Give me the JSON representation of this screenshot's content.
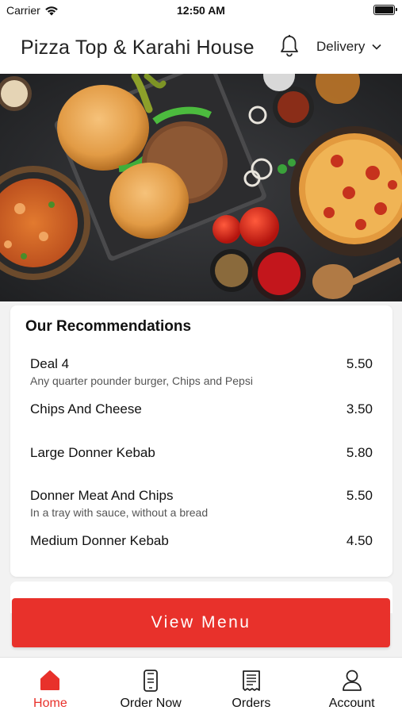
{
  "status_bar": {
    "carrier": "Carrier",
    "time": "12:50 AM"
  },
  "header": {
    "title": "Pizza Top & Karahi House",
    "order_type": "Delivery"
  },
  "recommendations": {
    "title": "Our Recommendations",
    "items": [
      {
        "name": "Deal 4",
        "description": "Any quarter pounder burger, Chips and Pepsi",
        "price": "5.50"
      },
      {
        "name": "Chips And Cheese",
        "description": "",
        "price": "3.50"
      },
      {
        "name": "Large Donner Kebab",
        "description": "",
        "price": "5.80"
      },
      {
        "name": "Donner Meat And Chips",
        "description": "In a tray with sauce, without a bread",
        "price": "5.50"
      },
      {
        "name": "Medium Donner Kebab",
        "description": "",
        "price": "4.50"
      }
    ]
  },
  "view_menu_label": "View Menu",
  "tabs": [
    {
      "label": "Home",
      "icon": "home-icon",
      "active": true
    },
    {
      "label": "Order Now",
      "icon": "phone-order-icon",
      "active": false
    },
    {
      "label": "Orders",
      "icon": "receipt-icon",
      "active": false
    },
    {
      "label": "Account",
      "icon": "person-icon",
      "active": false
    }
  ],
  "colors": {
    "accent": "#e8312b",
    "background": "#f2f2f2"
  }
}
